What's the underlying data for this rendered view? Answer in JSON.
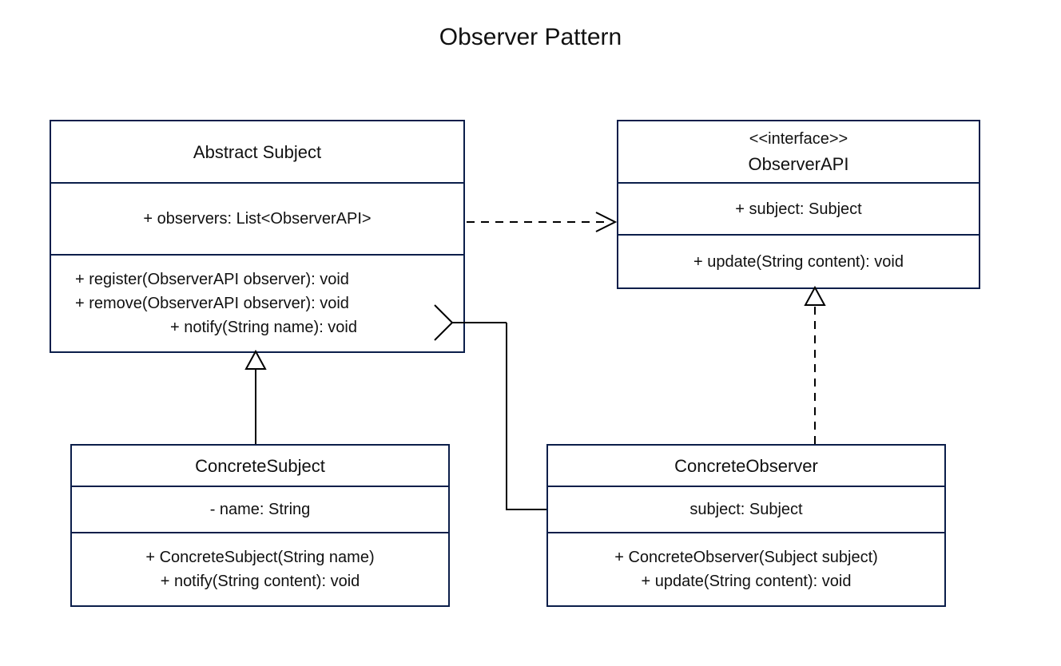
{
  "title": "Observer Pattern",
  "classes": {
    "abstract_subject": {
      "name": "Abstract Subject",
      "attributes": [
        "+   observers: List<ObserverAPI>"
      ],
      "methods": [
        "+  register(ObserverAPI observer): void",
        "+  remove(ObserverAPI observer): void",
        "+  notify(String name): void"
      ]
    },
    "observer_api": {
      "stereotype": "<<interface>>",
      "name": "ObserverAPI",
      "attributes": [
        "+   subject: Subject"
      ],
      "methods": [
        "+  update(String content): void"
      ]
    },
    "concrete_subject": {
      "name": "ConcreteSubject",
      "attributes": [
        "-   name: String"
      ],
      "methods": [
        "+   ConcreteSubject(String name)",
        "+   notify(String content): void"
      ]
    },
    "concrete_observer": {
      "name": "ConcreteObserver",
      "attributes": [
        "subject: Subject"
      ],
      "methods": [
        "+   ConcreteObserver(Subject subject)",
        "+   update(String content): void"
      ]
    }
  },
  "relationships": [
    {
      "from": "ConcreteSubject",
      "to": "Abstract Subject",
      "type": "generalization"
    },
    {
      "from": "ConcreteObserver",
      "to": "ObserverAPI",
      "type": "realization"
    },
    {
      "from": "Abstract Subject",
      "to": "ObserverAPI",
      "type": "dependency"
    },
    {
      "from": "ConcreteObserver",
      "to": "Abstract Subject",
      "type": "association-arrow"
    }
  ]
}
